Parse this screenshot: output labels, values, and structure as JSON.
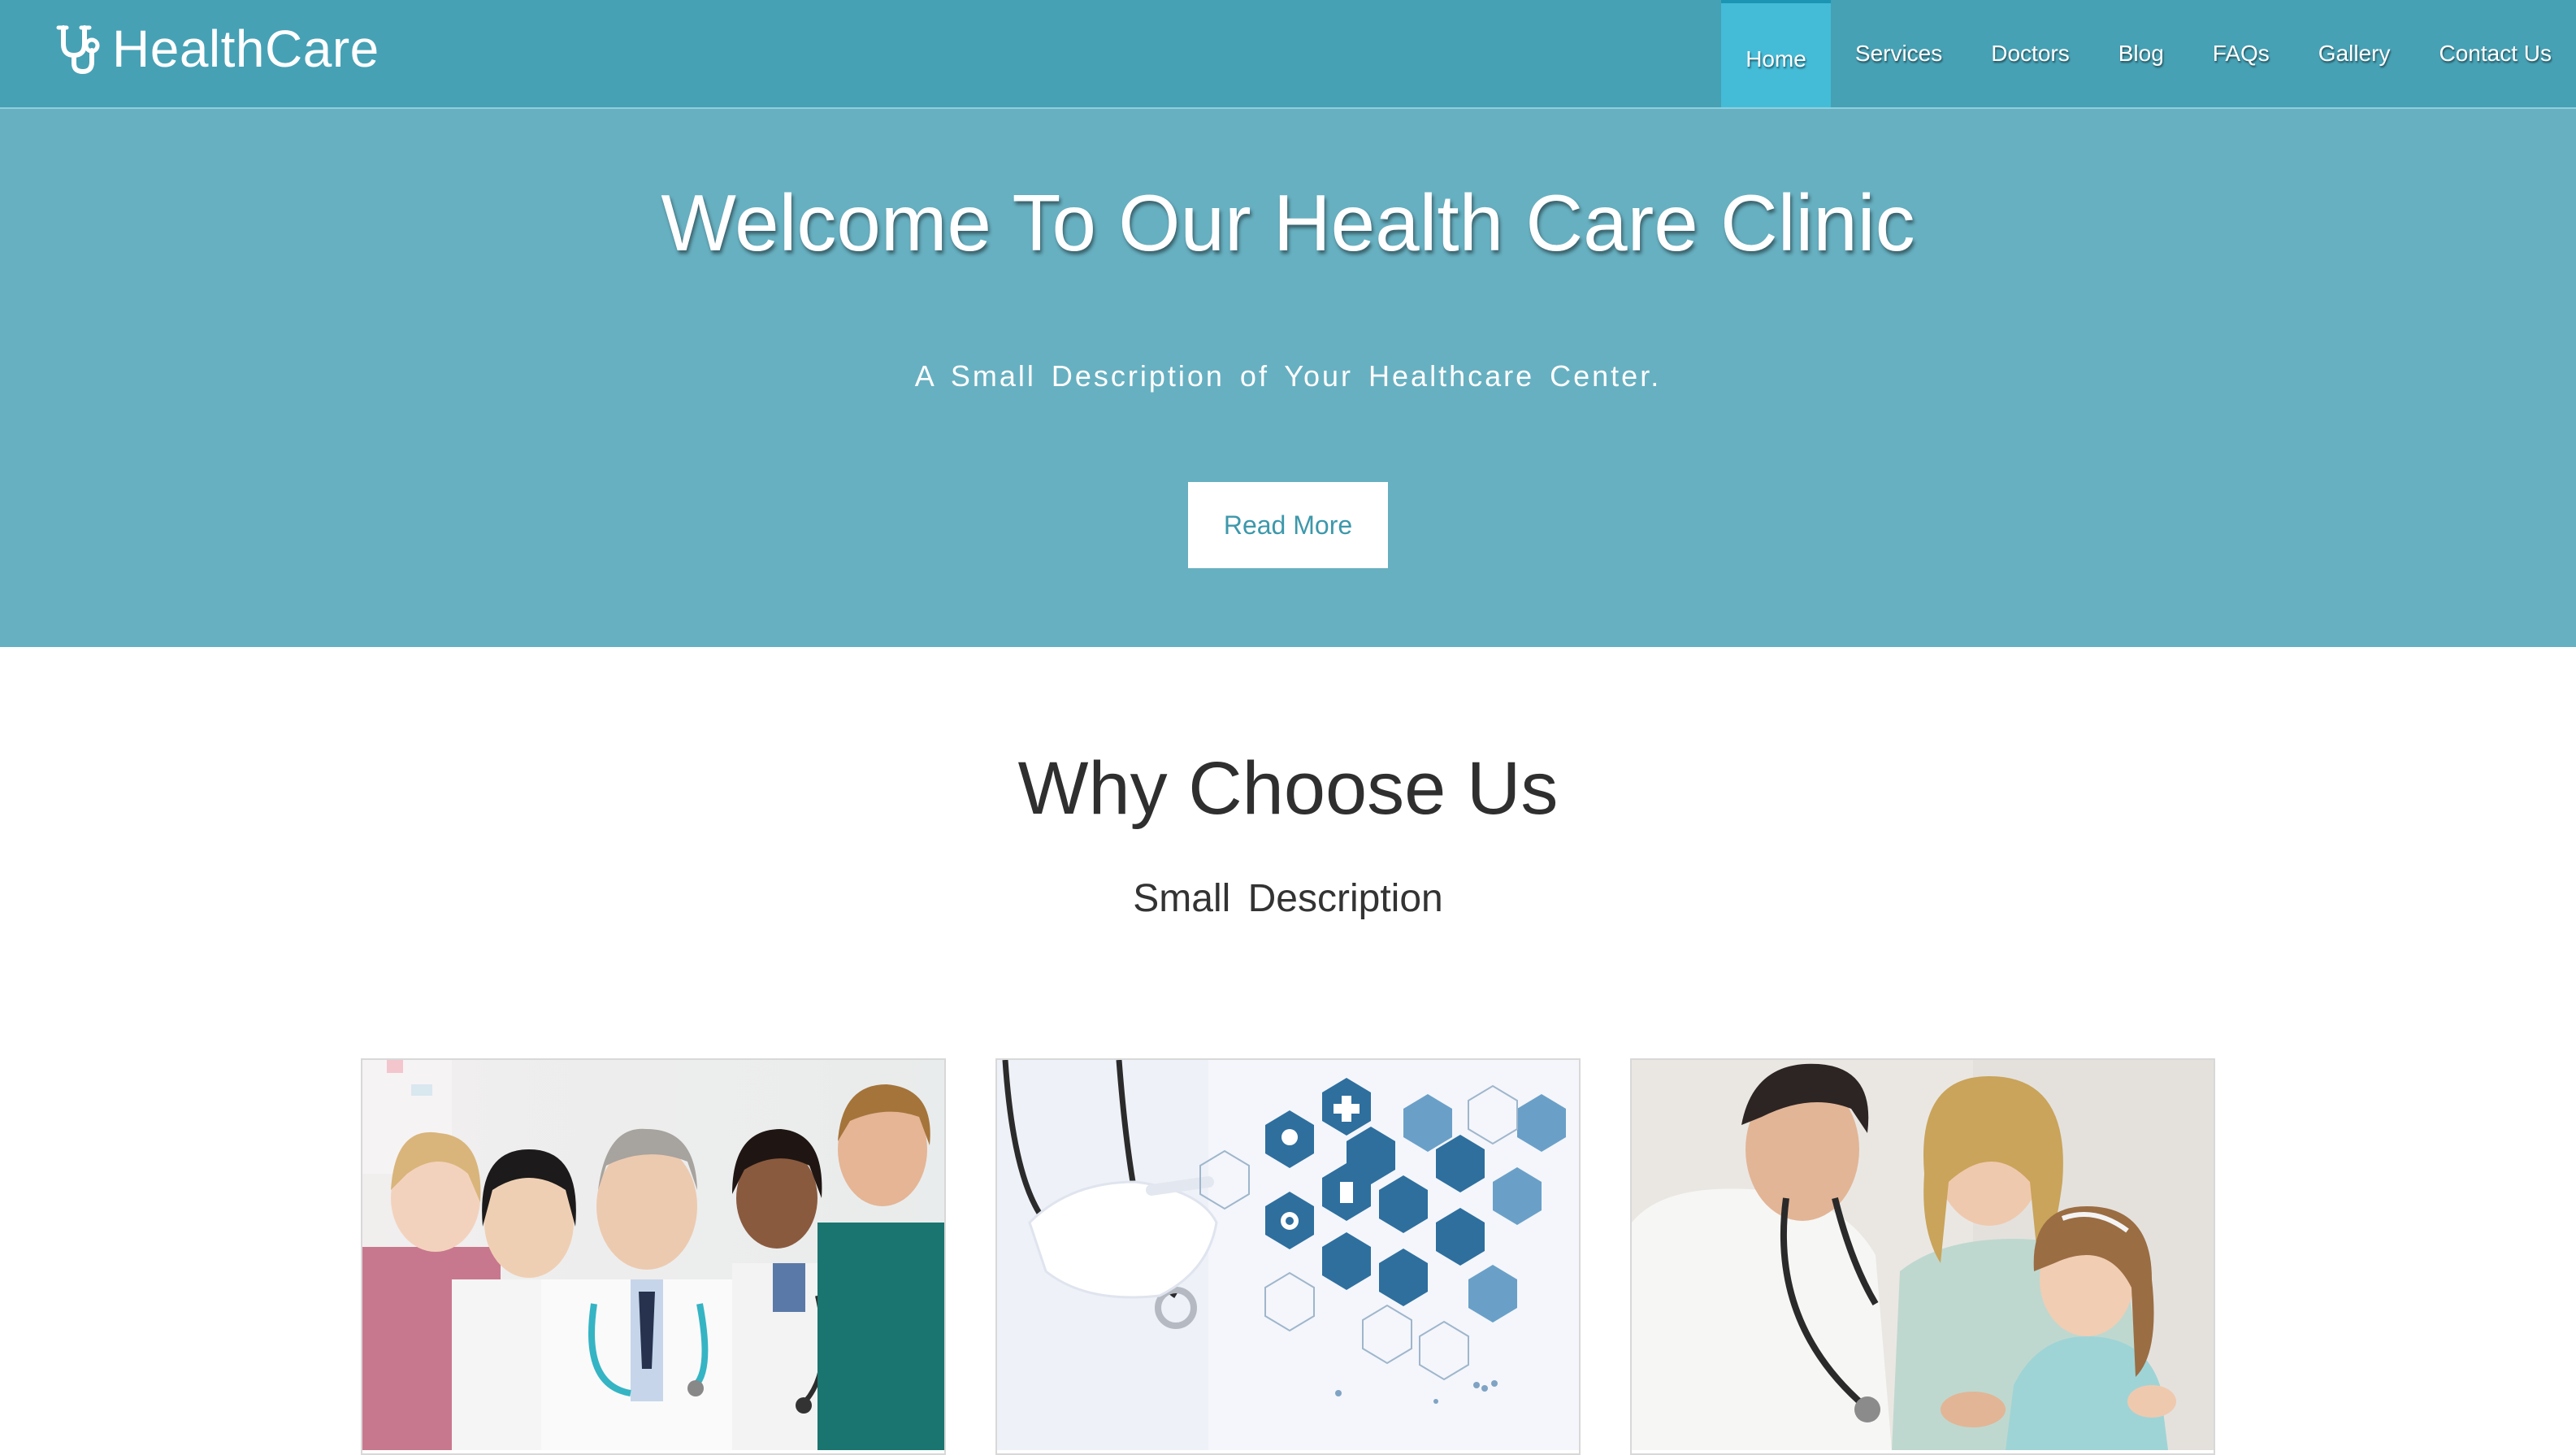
{
  "brand": {
    "name": "HealthCare",
    "icon": "stethoscope-icon"
  },
  "nav": {
    "items": [
      {
        "label": "Home",
        "active": true
      },
      {
        "label": "Services",
        "active": false
      },
      {
        "label": "Doctors",
        "active": false
      },
      {
        "label": "Blog",
        "active": false
      },
      {
        "label": "FAQs",
        "active": false
      },
      {
        "label": "Gallery",
        "active": false
      },
      {
        "label": "Contact Us",
        "active": false
      }
    ]
  },
  "hero": {
    "title": "Welcome To Our Health Care Clinic",
    "subtitle": "A Small Description of Your Healthcare Center.",
    "button_label": "Read More"
  },
  "why": {
    "title": "Why Choose Us",
    "subtitle": "Small Description"
  },
  "cards": [
    {
      "image": "medical-team-photo"
    },
    {
      "image": "medical-technology-photo"
    },
    {
      "image": "doctor-child-patient-photo"
    }
  ],
  "colors": {
    "navbar": "#46a1b5",
    "nav_active": "#44bcd8",
    "hero": "#67b0c1",
    "button_text": "#3d98ab",
    "heading_text": "#2f2f2f"
  }
}
